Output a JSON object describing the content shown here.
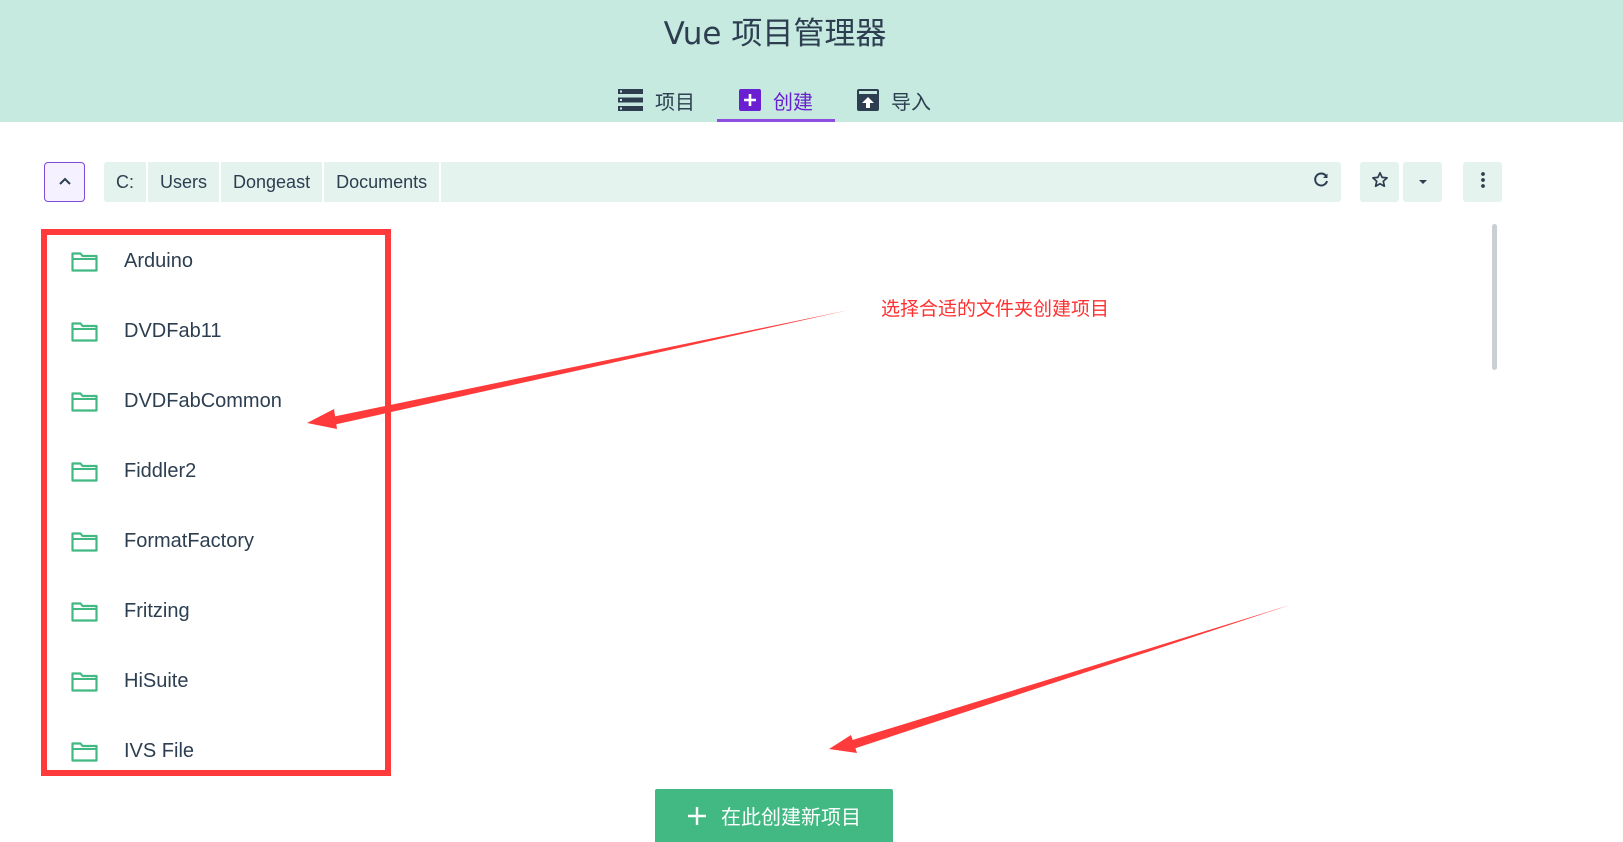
{
  "header": {
    "title": "Vue 项目管理器",
    "tabs": [
      {
        "label": "项目",
        "icon": "list-icon",
        "active": false
      },
      {
        "label": "创建",
        "icon": "add-box-icon",
        "active": true
      },
      {
        "label": "导入",
        "icon": "import-icon",
        "active": false
      }
    ]
  },
  "toolbar": {
    "breadcrumb": [
      "C:",
      "Users",
      "Dongeast",
      "Documents"
    ],
    "icons": [
      "chevron-up-icon",
      "pencil-icon",
      "refresh-icon",
      "star-icon",
      "dropdown-arrow-icon",
      "more-vert-icon"
    ]
  },
  "folders": [
    {
      "name": "Arduino"
    },
    {
      "name": "DVDFab11"
    },
    {
      "name": "DVDFabCommon"
    },
    {
      "name": "Fiddler2"
    },
    {
      "name": "FormatFactory"
    },
    {
      "name": "Fritzing"
    },
    {
      "name": "HiSuite"
    },
    {
      "name": "IVS File"
    }
  ],
  "annotation": {
    "text": "选择合适的文件夹创建项目",
    "color": "#ff3030"
  },
  "create_button": {
    "label": "在此创建新项目",
    "icon": "plus-icon"
  },
  "colors": {
    "header_bg": "#c6eadf",
    "accent": "#42b983",
    "active_tab": "#6a1fd0",
    "annotation_red": "#ff3a3a"
  }
}
